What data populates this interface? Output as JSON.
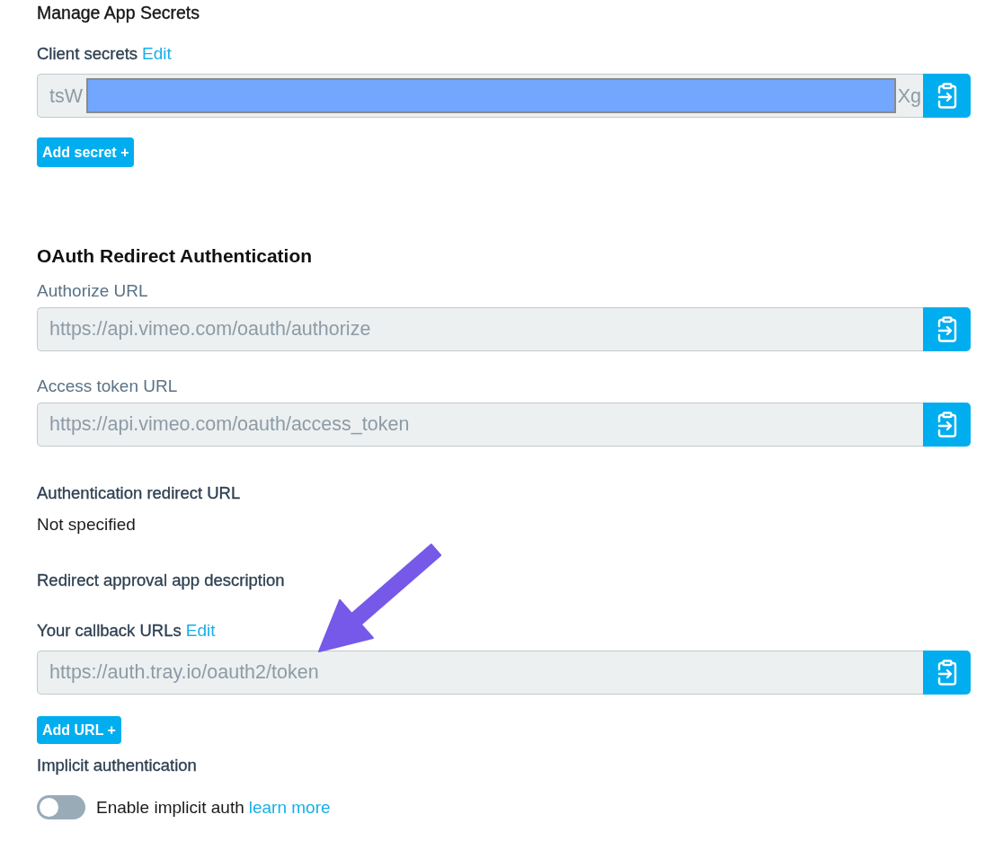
{
  "secrets": {
    "title": "Manage App Secrets",
    "label": "Client secrets",
    "edit_link": "Edit",
    "field": {
      "value_start": "tsW",
      "value_end": "Xg",
      "redacted": true
    },
    "add_button": "Add secret +"
  },
  "oauth": {
    "title": "OAuth Redirect Authentication",
    "url_fields": [
      {
        "label": "Authorize URL",
        "value": "https://api.vimeo.com/oauth/authorize"
      },
      {
        "label": "Access token URL",
        "value": "https://api.vimeo.com/oauth/access_token"
      }
    ],
    "redirect_url": {
      "label": "Authentication redirect URL",
      "value": "Not specified"
    },
    "approval_description": {
      "label": "Redirect approval app description"
    },
    "callback_urls": {
      "label": "Your callback URLs",
      "edit_link": "Edit",
      "urls": [
        "https://auth.tray.io/oauth2/token"
      ],
      "add_button": "Add URL +"
    },
    "implicit": {
      "title": "Implicit authentication",
      "toggle": {
        "on": false,
        "label": "Enable implicit auth",
        "link": "learn more"
      }
    }
  },
  "annotations": [
    {
      "kind": "arrow"
    }
  ]
}
